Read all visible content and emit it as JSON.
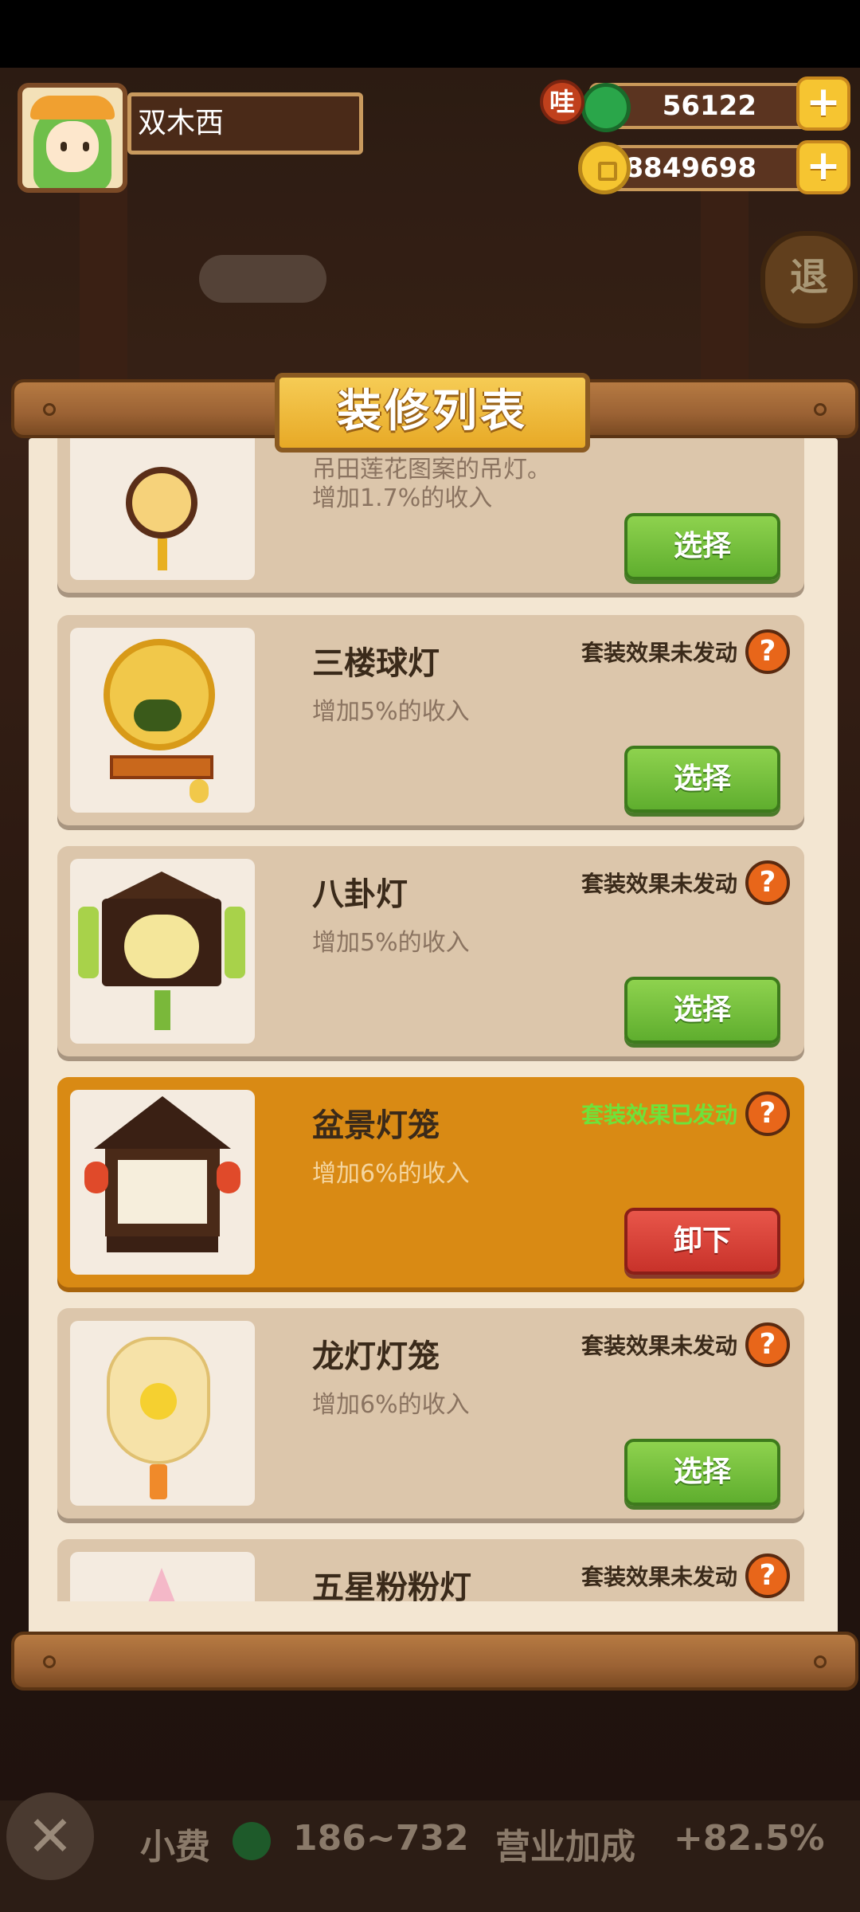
{
  "header": {
    "player_name": "双木西",
    "jade_badge": "哇",
    "jade_amount": "56122",
    "coin_amount": "8849698",
    "plus_label": "+"
  },
  "background": {
    "exit_label": "退"
  },
  "panel": {
    "title": "装修列表",
    "items": [
      {
        "name": "",
        "desc": "增加1.7%的收入",
        "partial_desc": "吊田莲花图案的吊灯。",
        "status": "",
        "action": "选择",
        "equipped": false
      },
      {
        "name": "三楼球灯",
        "desc": "增加5%的收入",
        "status": "套装效果未发动",
        "action": "选择",
        "equipped": false
      },
      {
        "name": "八卦灯",
        "desc": "增加5%的收入",
        "status": "套装效果未发动",
        "action": "选择",
        "equipped": false
      },
      {
        "name": "盆景灯笼",
        "desc": "增加6%的收入",
        "status": "套装效果已发动",
        "action": "卸下",
        "equipped": true
      },
      {
        "name": "龙灯灯笼",
        "desc": "增加6%的收入",
        "status": "套装效果未发动",
        "action": "选择",
        "equipped": false
      },
      {
        "name": "五星粉粉灯",
        "desc": "",
        "status": "套装效果未发动",
        "action": "",
        "equipped": false
      }
    ],
    "help_label": "?"
  },
  "footer": {
    "close_label": "✕",
    "tip_label": "小费",
    "tip_range": "186~732",
    "bonus_label": "营业加成",
    "bonus_value": "+82.5%"
  },
  "colors": {
    "equipped_card": "#d98a14",
    "select_button": "#6fbe38",
    "remove_button": "#d8423a",
    "status_active": "#6fe23a"
  }
}
